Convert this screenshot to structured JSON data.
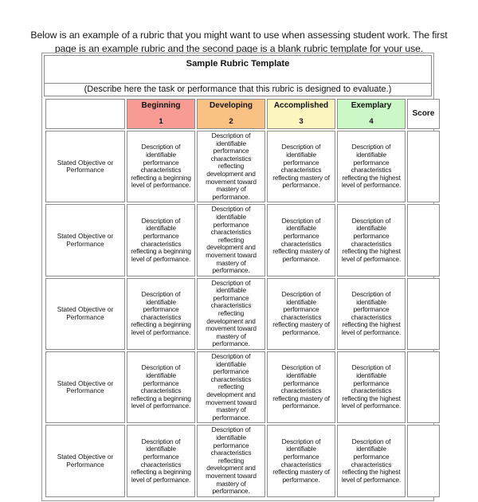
{
  "intro": {
    "text": "Below is an example of a rubric that you might want to use when assessing student work.  The first page is an example rubric and the second page is a blank rubric template for your use."
  },
  "rubric": {
    "title": "Sample Rubric Template",
    "describe_prompt": "(Describe here the task or performance that this rubric is designed to evaluate.)",
    "blank_corner_label": "",
    "score_header": "Score",
    "levels": [
      {
        "label": "Beginning",
        "number": "1",
        "color": "#f99b95"
      },
      {
        "label": "Developing",
        "number": "2",
        "color": "#fac184"
      },
      {
        "label": "Accomplished",
        "number": "3",
        "color": "#fdf5bf"
      },
      {
        "label": "Exemplary",
        "number": "4",
        "color": "#ccf7c6"
      }
    ],
    "descriptions": [
      "Description of identifiable performance characteristics reflecting a beginning level of performance.",
      "Description of identifiable performance characteristics reflecting development and movement toward mastery of performance.",
      "Description of identifiable performance characteristics reflecting mastery of performance.",
      "Description of identifiable performance characteristics reflecting the highest level of performance."
    ],
    "objective_label": "Stated Objective or Performance",
    "rows": [
      {
        "objective": "Stated Objective or Performance",
        "score": ""
      },
      {
        "objective": "Stated Objective or Performance",
        "score": ""
      },
      {
        "objective": "Stated Objective or Performance",
        "score": ""
      },
      {
        "objective": "Stated Objective or Performance",
        "score": ""
      },
      {
        "objective": "Stated Objective or Performance",
        "score": ""
      }
    ]
  }
}
